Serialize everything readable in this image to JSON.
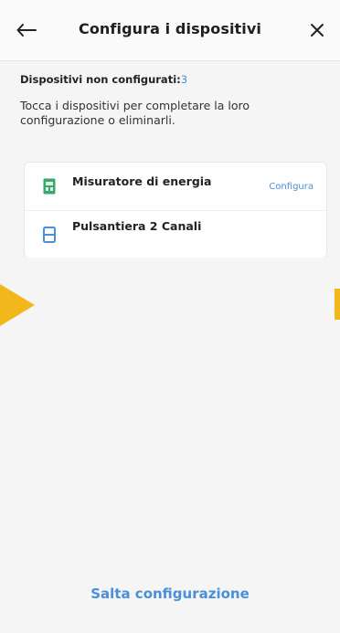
{
  "header": {
    "title": "Configura i dispositivi",
    "back_icon": "arrow-left-icon",
    "close_icon": "close-icon"
  },
  "summary": {
    "label": "Dispositivi non configurati:",
    "count": "3"
  },
  "instructions": "Tocca i dispositivi per completare la loro configurazione o eliminarli.",
  "devices": [
    {
      "name": "Misuratore di energia",
      "icon": "energy-meter-icon",
      "icon_color": "#3aa76d",
      "action": "Configura"
    },
    {
      "name": "Pulsantiera 2 Canali",
      "icon": "button-panel-icon",
      "icon_color": "#4a8fd8"
    }
  ],
  "footer": {
    "skip_label": "Salta configurazione"
  },
  "colors": {
    "accent": "#4a8fd8",
    "arrow": "#f2b81b",
    "background": "#f5f5f5"
  }
}
